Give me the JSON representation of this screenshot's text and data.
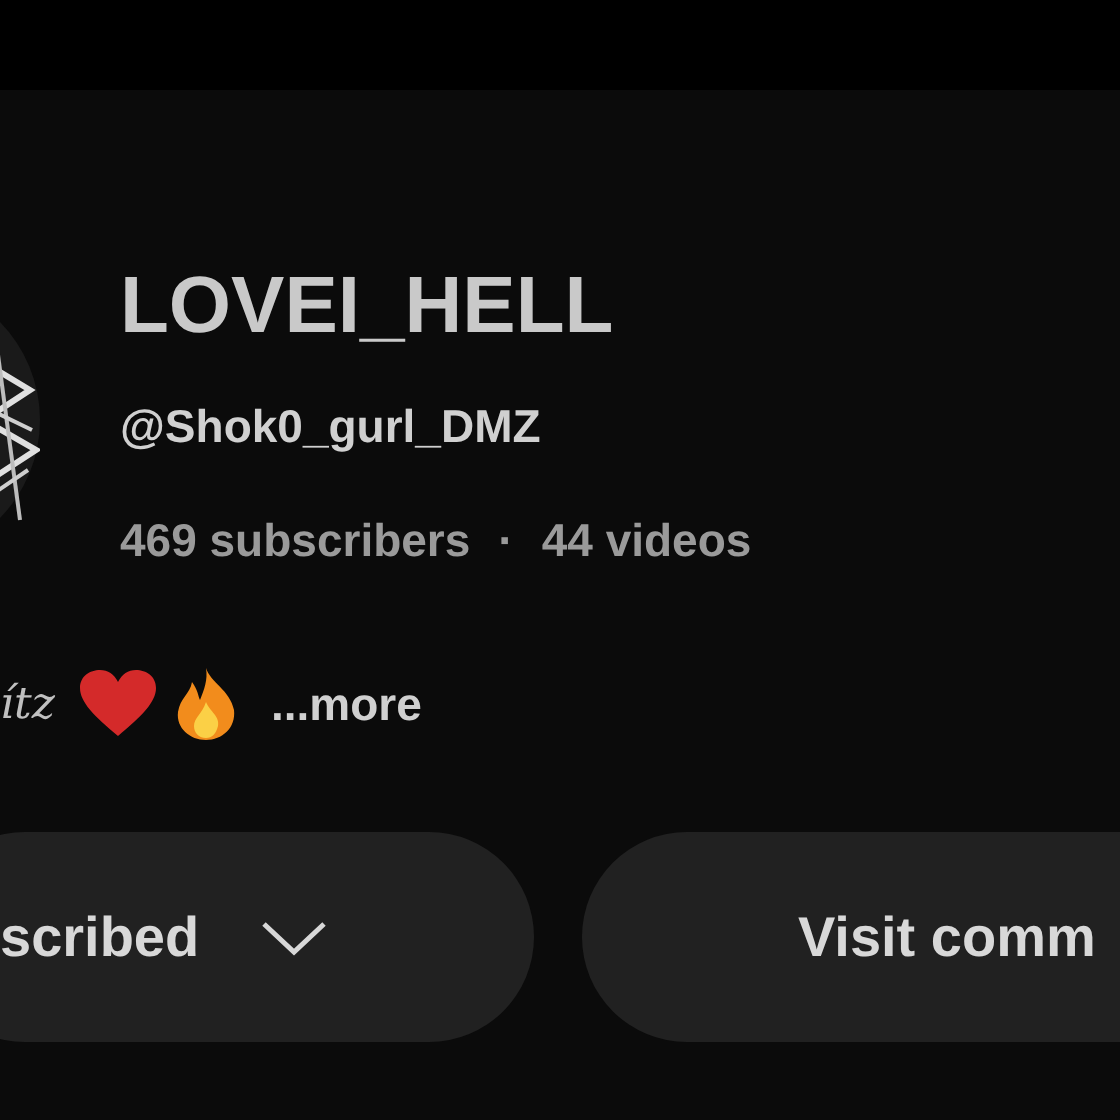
{
  "channel": {
    "name": "LOVEI_HELL",
    "handle": "@Shok0_gurl_DMZ",
    "subscribers": "469 subscribers",
    "separator": "·",
    "videos": "44 videos"
  },
  "description": {
    "text": "ítz",
    "more": "...more"
  },
  "buttons": [
    {
      "label": "scribed",
      "kind": "subscribed"
    },
    {
      "label": "Visit comm",
      "kind": "link"
    }
  ]
}
